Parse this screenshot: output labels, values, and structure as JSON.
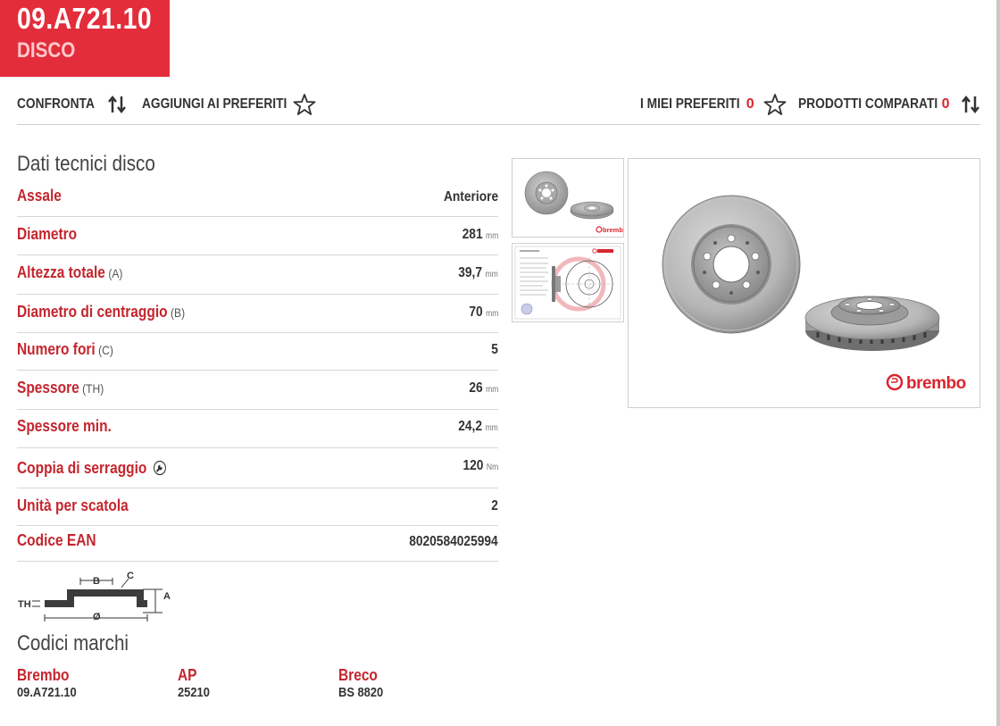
{
  "header": {
    "code": "09.A721.10",
    "type": "DISCO"
  },
  "toolbar": {
    "compare": {
      "label": "CONFRONTA",
      "icon": "compare-arrows-icon"
    },
    "add_favorites": {
      "label": "AGGIUNGI AI PREFERITI",
      "icon": "star-outline-icon"
    },
    "my_favorites": {
      "label": "I MIEI PREFERITI",
      "count": "0",
      "icon": "star-outline-icon"
    },
    "compared": {
      "label": "PRODOTTI COMPARATI",
      "count": "0",
      "icon": "compare-arrows-icon"
    }
  },
  "tech": {
    "title": "Dati tecnici disco",
    "rows": [
      {
        "label": "Assale",
        "sub": "",
        "value": "Anteriore",
        "unit": ""
      },
      {
        "label": "Diametro",
        "sub": "",
        "value": "281",
        "unit": "mm"
      },
      {
        "label": "Altezza totale",
        "sub": "(A)",
        "value": "39,7",
        "unit": "mm"
      },
      {
        "label": "Diametro di centraggio",
        "sub": "(B)",
        "value": "70",
        "unit": "mm"
      },
      {
        "label": "Numero fori",
        "sub": "(C)",
        "value": "5",
        "unit": ""
      },
      {
        "label": "Spessore",
        "sub": "(TH)",
        "value": "26",
        "unit": "mm"
      },
      {
        "label": "Spessore min.",
        "sub": "",
        "value": "24,2",
        "unit": "mm"
      },
      {
        "label": "Coppia di serraggio",
        "sub": "",
        "value": "120",
        "unit": "Nm",
        "icon": "wrench-icon"
      },
      {
        "label": "Unità per scatola",
        "sub": "",
        "value": "2",
        "unit": ""
      },
      {
        "label": "Codice EAN",
        "sub": "",
        "value": "8020584025994",
        "unit": ""
      }
    ]
  },
  "diagram": {
    "th": "TH",
    "b": "B",
    "c": "C",
    "a": "A",
    "diam": "Ø"
  },
  "brands": {
    "title": "Codici marchi",
    "items": [
      {
        "brand": "Brembo",
        "code": "09.A721.10"
      },
      {
        "brand": "AP",
        "code": "25210"
      },
      {
        "brand": "Breco",
        "code": "BS 8820"
      }
    ]
  },
  "images": {
    "logo_text": "brembo"
  },
  "colors": {
    "accent": "#e32d3b",
    "label_red": "#c4262e",
    "text": "#333333",
    "divider": "#d6d6d6"
  }
}
